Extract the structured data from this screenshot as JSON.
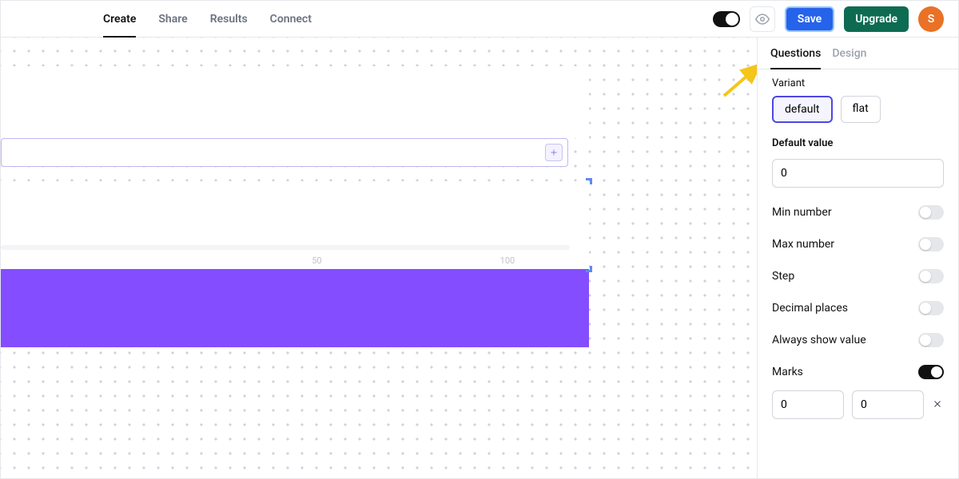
{
  "header": {
    "tabs": {
      "create": "Create",
      "share": "Share",
      "results": "Results",
      "connect": "Connect"
    },
    "save_label": "Save",
    "upgrade_label": "Upgrade",
    "avatar_initial": "S"
  },
  "canvas": {
    "slider_mark_mid": "50",
    "slider_mark_max": "100"
  },
  "sidebar": {
    "tabs": {
      "questions": "Questions",
      "design": "Design"
    },
    "variant_label": "Variant",
    "variant_options": {
      "default": "default",
      "flat": "flat"
    },
    "default_value_label": "Default value",
    "default_value": "0",
    "options": {
      "min_number": "Min number",
      "max_number": "Max number",
      "step": "Step",
      "decimal_places": "Decimal places",
      "always_show_value": "Always show value",
      "marks": "Marks"
    },
    "marks_input1": "0",
    "marks_input2": "0"
  }
}
